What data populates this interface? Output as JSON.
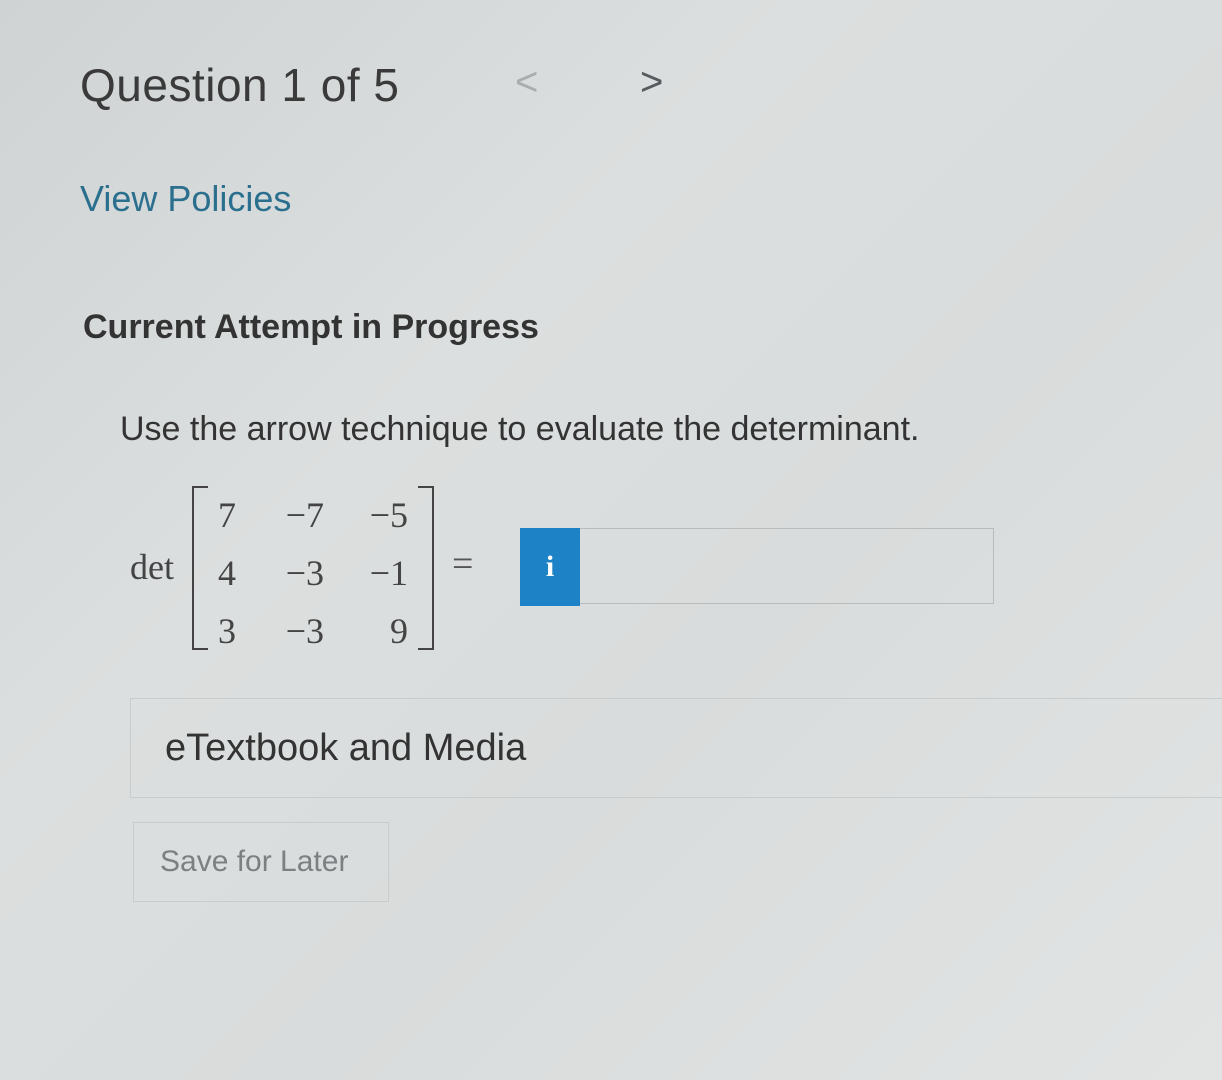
{
  "header": {
    "question_title": "Question 1 of 5",
    "prev_glyph": "<",
    "next_glyph": ">"
  },
  "links": {
    "view_policies": "View Policies"
  },
  "attempt": {
    "heading": "Current Attempt in Progress"
  },
  "question": {
    "prompt": "Use the arrow technique to evaluate the determinant.",
    "det_label": "det",
    "matrix": [
      [
        "7",
        "−7",
        "−5"
      ],
      [
        "4",
        "−3",
        "−1"
      ],
      [
        "3",
        "−3",
        "9"
      ]
    ],
    "equals": "=",
    "info_button_label": "i",
    "answer_value": ""
  },
  "etextbook": {
    "label": "eTextbook and Media"
  },
  "actions": {
    "save_for_later": "Save for Later"
  },
  "colors": {
    "link": "#2b6f8e",
    "info_button": "#1e83c6"
  }
}
